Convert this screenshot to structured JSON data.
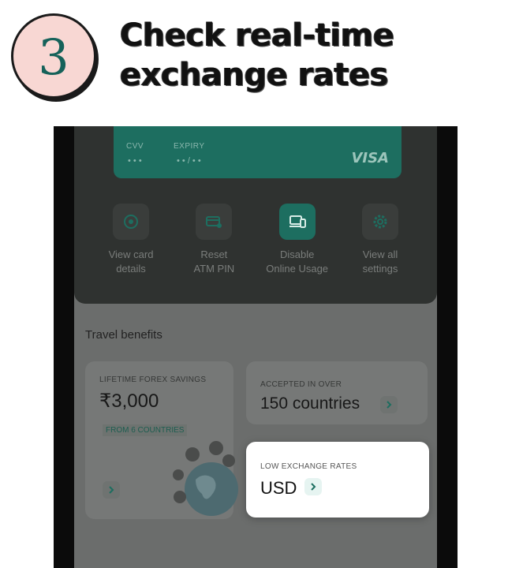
{
  "header": {
    "step_number": "3",
    "headline_line1": "Check real-time",
    "headline_line2": "exchange rates"
  },
  "card": {
    "cvv_label": "CVV",
    "cvv_value": "• • •",
    "expiry_label": "EXPIRY",
    "expiry_value": "• • / • •",
    "network": "VISA"
  },
  "actions": [
    {
      "label_line1": "View card",
      "label_line2": "details",
      "icon": "eye-icon"
    },
    {
      "label_line1": "Reset",
      "label_line2": "ATM PIN",
      "icon": "atm-card-icon"
    },
    {
      "label_line1": "Disable",
      "label_line2": "Online Usage",
      "icon": "laptop-phone-icon"
    },
    {
      "label_line1": "View all",
      "label_line2": "settings",
      "icon": "gear-icon"
    }
  ],
  "travel": {
    "title": "Travel benefits",
    "savings": {
      "label": "LIFETIME FOREX SAVINGS",
      "value": "₹3,000",
      "chip": "FROM 6 COUNTRIES"
    },
    "accepted": {
      "label": "ACCEPTED IN OVER",
      "value": "150 countries"
    },
    "rates": {
      "label": "LOW EXCHANGE RATES",
      "value": "USD"
    }
  },
  "colors": {
    "brand_green": "#1d6e60",
    "badge_pink": "#f8d7d3"
  }
}
